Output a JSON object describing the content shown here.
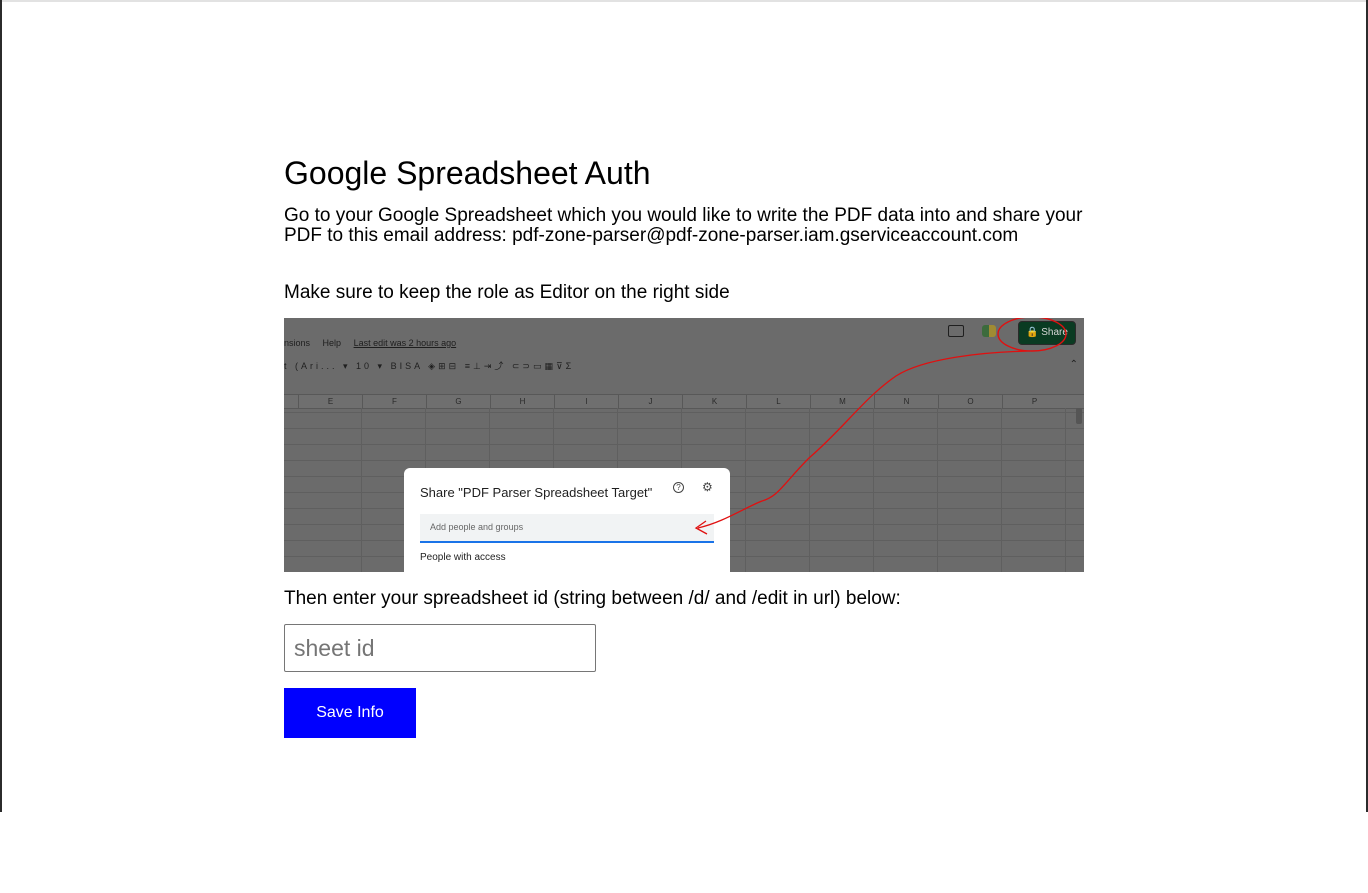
{
  "page": {
    "title": "Google Spreadsheet Auth",
    "description": "Go to your Google Spreadsheet which you would like to write the PDF data into and share your PDF to this email address: pdf-zone-parser@pdf-zone-parser.iam.gserviceaccount.com",
    "role_note": "Make sure to keep the role as Editor on the right side",
    "instruction": "Then enter your spreadsheet id (string between /d/ and /edit in url) below:"
  },
  "form": {
    "sheet_id_value": "",
    "sheet_id_placeholder": "sheet id",
    "save_label": "Save Info",
    "save_color": "#0000ff"
  },
  "screenshot": {
    "menu_items": [
      "nsions",
      "Help"
    ],
    "last_edit": "Last edit was 2 hours ago",
    "font_name": "t (Ari... ▾",
    "font_size": "10 ▾",
    "share_button": "🔒 Share",
    "columns": [
      "E",
      "F",
      "G",
      "H",
      "I",
      "J",
      "K",
      "L",
      "M",
      "N",
      "O",
      "P"
    ],
    "dialog_title": "Share \"PDF Parser Spreadsheet Target\"",
    "dialog_input_placeholder": "Add people and groups",
    "dialog_access_label": "People with access",
    "annotation_color": "#e01010"
  }
}
